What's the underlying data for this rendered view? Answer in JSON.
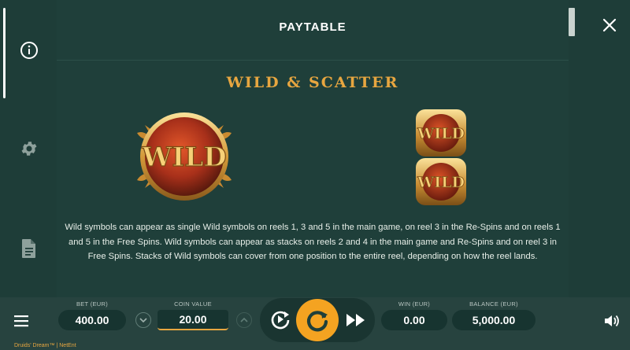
{
  "panel": {
    "title": "PAYTABLE",
    "section_heading": "WILD & SCATTER",
    "big_symbol_text": "WILD",
    "stack_symbol_text": "WILD",
    "description": "Wild symbols can appear as single Wild symbols on reels 1, 3 and 5 in the main game, on reel 3 in the Re-Spins and on reels 1 and 5 in the Free Spins. Wild symbols can appear as stacks on reels 2 and 4 in the main game and Re-Spins and on reel 3 in Free Spins. Stacks of Wild symbols can cover from one position to the entire reel, depending on how the reel lands."
  },
  "sidebar": {
    "items": [
      {
        "icon": "info-icon"
      },
      {
        "icon": "gear-icon"
      },
      {
        "icon": "document-icon"
      }
    ]
  },
  "bottom_bar": {
    "bet_label": "BET (EUR)",
    "bet_value": "400.00",
    "coin_label": "COIN VALUE",
    "coin_value": "20.00",
    "win_label": "WIN (EUR)",
    "win_value": "0.00",
    "balance_label": "BALANCE (EUR)",
    "balance_value": "5,000.00"
  },
  "footer": {
    "game_name": "Druids' Dream™",
    "separator": "|",
    "provider": "NetEnt"
  },
  "colors": {
    "background": "#1e3d38",
    "accent_gold": "#e7a640",
    "spin_button": "#f4a321",
    "pill": "#173430"
  }
}
